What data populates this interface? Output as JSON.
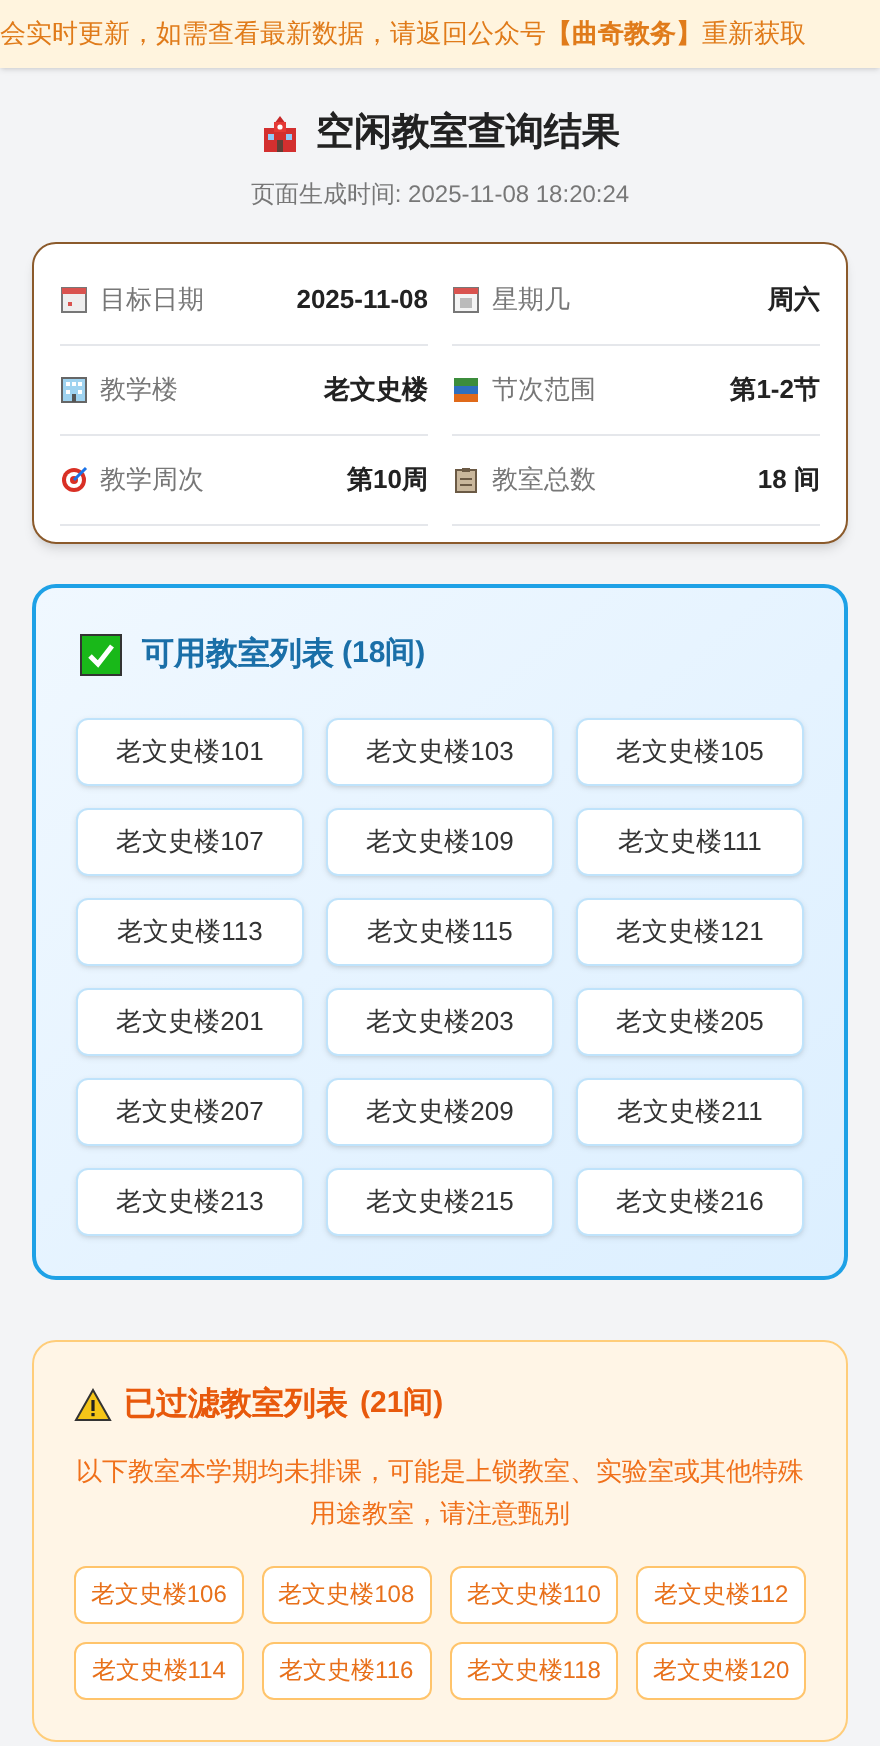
{
  "notice": "会实时更新，如需查看最新数据，请返回公众号**【曲奇教务】**重新获取",
  "header": {
    "title": "空闲教室查询结果",
    "generated": "页面生成时间: 2025-11-08 18:20:24"
  },
  "info": [
    {
      "kind": "date",
      "label": "目标日期",
      "value": "2025-11-08"
    },
    {
      "kind": "weekday",
      "label": "星期几",
      "value": "周六"
    },
    {
      "kind": "building",
      "label": "教学楼",
      "value": "老文史楼"
    },
    {
      "kind": "periods",
      "label": "节次范围",
      "value": "第1-2节"
    },
    {
      "kind": "week",
      "label": "教学周次",
      "value": "第10周"
    },
    {
      "kind": "total",
      "label": "教室总数",
      "value": "18 间"
    }
  ],
  "available": {
    "title": "可用教室列表",
    "count": "(18间)",
    "rooms": [
      "老文史楼101",
      "老文史楼103",
      "老文史楼105",
      "老文史楼107",
      "老文史楼109",
      "老文史楼111",
      "老文史楼113",
      "老文史楼115",
      "老文史楼121",
      "老文史楼201",
      "老文史楼203",
      "老文史楼205",
      "老文史楼207",
      "老文史楼209",
      "老文史楼211",
      "老文史楼213",
      "老文史楼215",
      "老文史楼216"
    ]
  },
  "filtered": {
    "title": "已过滤教室列表",
    "count": "(21间)",
    "note": "以下教室本学期均未排课，可能是上锁教室、实验室或其他特殊用途教室，请注意甄别",
    "rooms": [
      "老文史楼106",
      "老文史楼108",
      "老文史楼110",
      "老文史楼112",
      "老文史楼114",
      "老文史楼116",
      "老文史楼118",
      "老文史楼120"
    ]
  }
}
